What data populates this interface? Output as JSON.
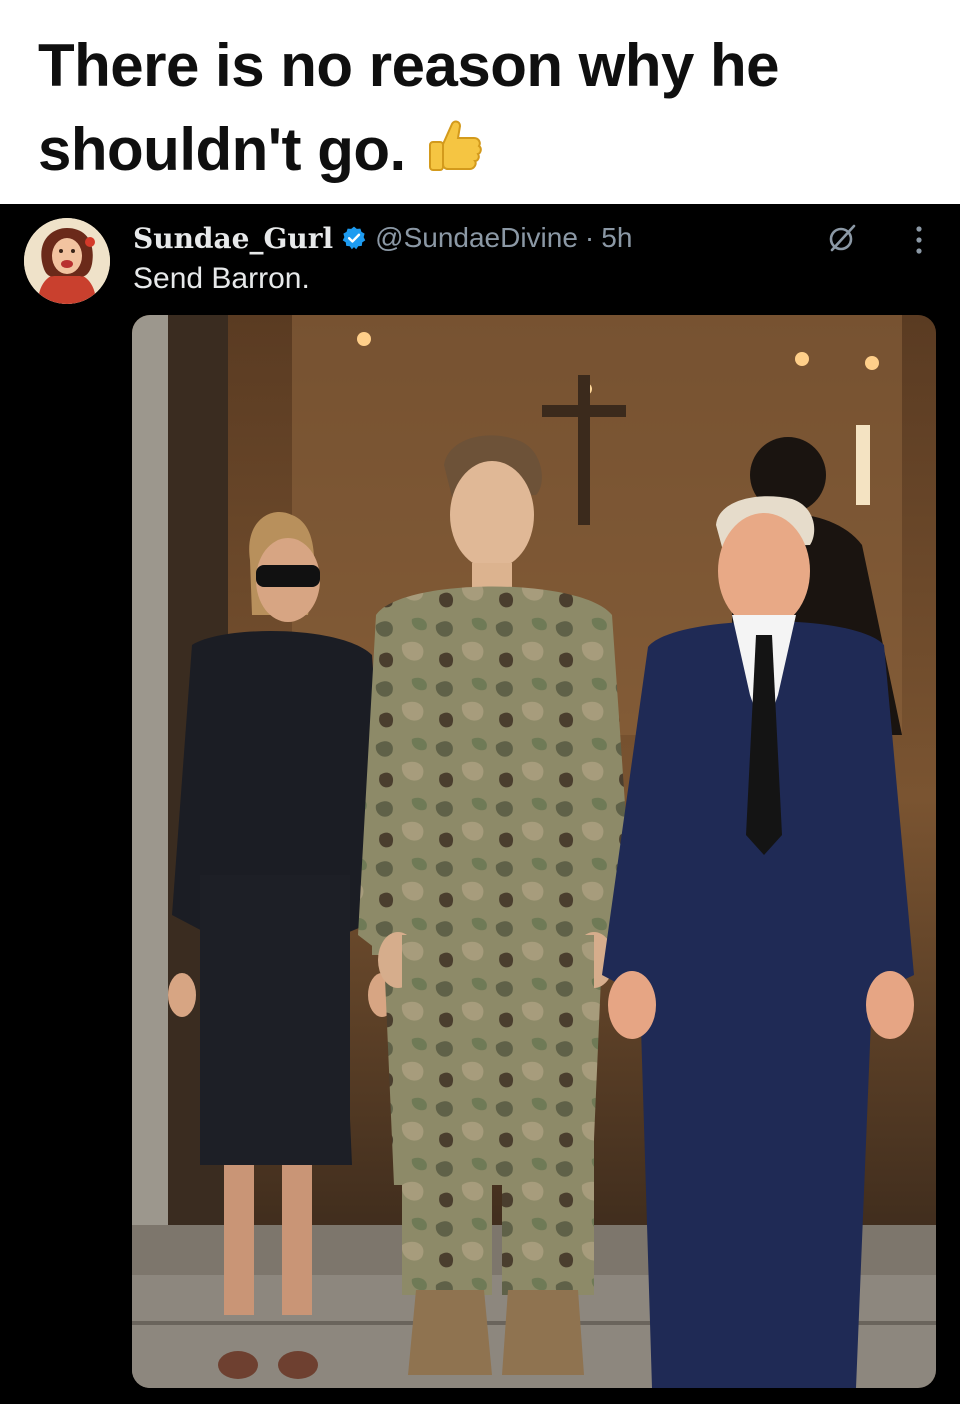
{
  "caption": {
    "text": "There is no reason why he shouldn't go.",
    "emoji": "thumbs-up-icon"
  },
  "tweet": {
    "display_name": "Sundae_Gurl",
    "verified": true,
    "handle": "@SundaeDivine",
    "separator": "·",
    "time": "5h",
    "text": "Send Barron."
  },
  "colors": {
    "background": "#000000",
    "caption_background": "#ffffff",
    "caption_text": "#0f0f0f",
    "tweet_text": "#e7e9ea",
    "secondary_text": "#8b98a5",
    "verified_badge": "#1d9bf0"
  },
  "icons": {
    "verified": "verified-badge-icon",
    "grok": "grok-icon",
    "more": "more-options-icon"
  },
  "media": {
    "kind": "photo"
  }
}
